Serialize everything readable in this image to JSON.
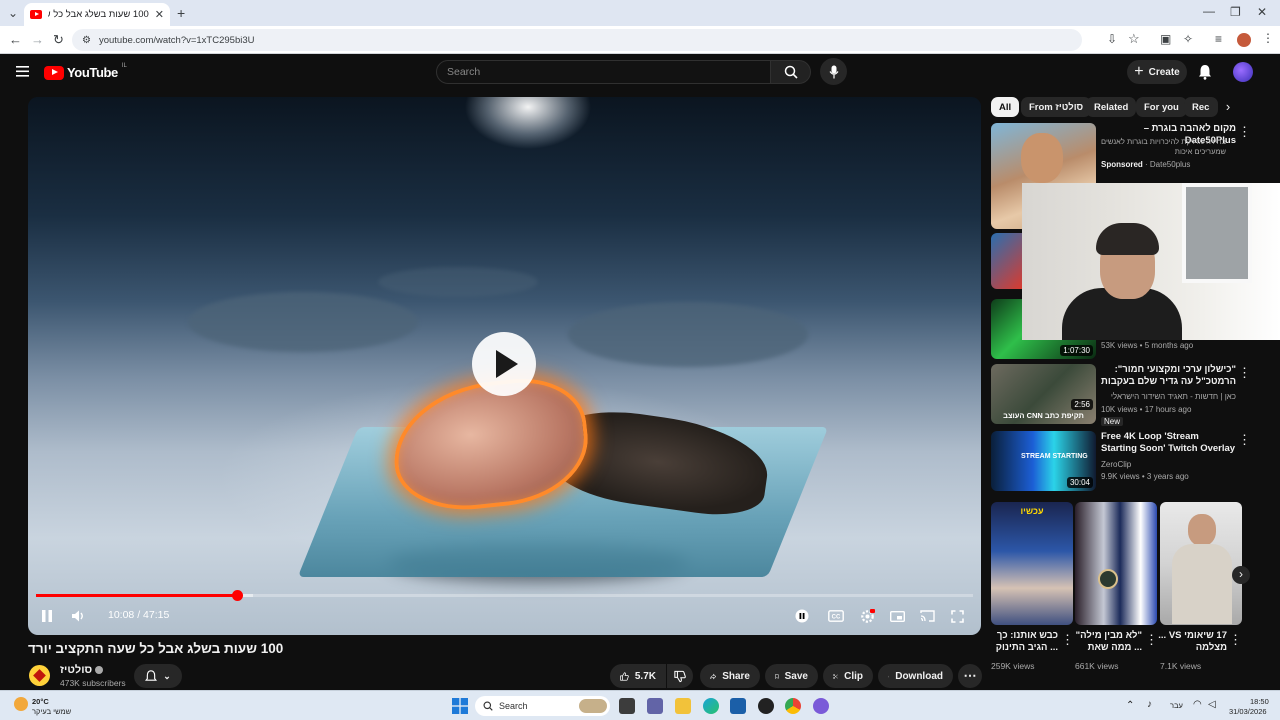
{
  "browser": {
    "tab_title": "100 שעות בשלג אבל כל שעה התקציב יורד",
    "url": "youtube.com/watch?v=1xTC295bi3U"
  },
  "header": {
    "logo_text": "YouTube",
    "logo_country": "IL",
    "search_placeholder": "Search",
    "create_label": "Create"
  },
  "player": {
    "time": "10:08 / 47:15",
    "progress_fraction": 0.214,
    "buffered_fraction": 0.232
  },
  "video": {
    "title": "100 שעות בשלג אבל כל שעה התקציב יורד",
    "channel": "סולטיז",
    "subscribers": "473K subscribers",
    "likes": "5.7K",
    "share_label": "Share",
    "save_label": "Save",
    "clip_label": "Clip",
    "download_label": "Download"
  },
  "chips": [
    "All",
    "From סולטיז",
    "Related",
    "For you",
    "Rec"
  ],
  "recommendations": [
    {
      "title": "מקום לאהבה בוגרת – Date50Plus",
      "line2": "בחירה מדויקת להיכרויות בוגרות לאנשים שמעריכים איכות",
      "badge": "Sponsored",
      "channel": "Date50plus"
    },
    {
      "duration": "1:07:30",
      "meta": "53K views • 5 months ago"
    },
    {
      "title": "\"כישלון ערכי ומקצועי חמור\": הרמטכ\"ל עה גדיר שלם בעקבות תקיפת כתב",
      "channel": "כאן | חדשות - תאגיד השידור הישראלי",
      "meta": "10K views • 17 hours ago",
      "badge": "New",
      "duration": "2:56",
      "thumb_caption": "תקיפת כתב CNN העוצב"
    },
    {
      "title": "Free 4K Loop 'Stream Starting Soon' Twitch Overlay OT6",
      "channel": "ZeroClip",
      "meta": "9.9K views • 3 years ago",
      "duration": "30:04",
      "thumb_caption": "STREAM STARTING"
    }
  ],
  "shorts": [
    {
      "title": "כבש אותנו: כך ... הגיב התינוק",
      "views": "259K views",
      "caption": "עכשיו"
    },
    {
      "title": "\"לא מבין מילה\" ... ממה שאת",
      "views": "661K views",
      "caption": ""
    },
    {
      "title": "17 שיאומי VS ... מצלמה",
      "views": "7.1K views",
      "caption": ""
    }
  ],
  "taskbar": {
    "weather_temp": "20°C",
    "weather_desc": "שמשי בעיקר",
    "search_label": "Search",
    "lang": "עבר",
    "time": "18:50",
    "date": "31/03/2026"
  },
  "colors": {
    "yt_red": "#ff0000",
    "background": "#0f0f0f",
    "chip": "#272727"
  },
  "icons": [
    "menu-icon",
    "search-icon",
    "mic-icon",
    "bell-icon",
    "pause-icon",
    "volume-icon",
    "settings-icon",
    "fullscreen-icon",
    "like-icon",
    "dislike-icon",
    "share-icon",
    "save-icon",
    "clip-icon",
    "download-icon",
    "more-icon"
  ]
}
